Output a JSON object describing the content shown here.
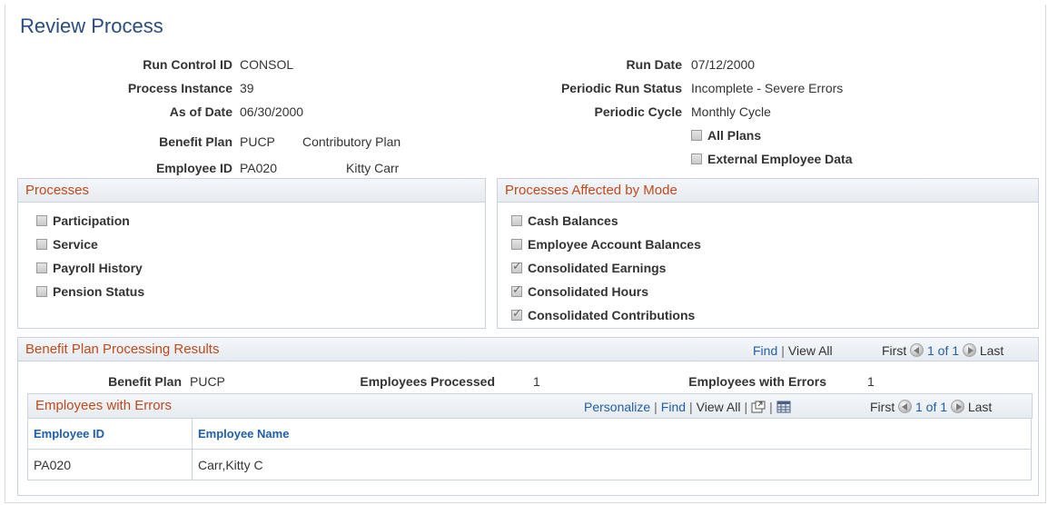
{
  "page": {
    "title": "Review Process"
  },
  "header_left": {
    "run_control_id": {
      "label": "Run Control ID",
      "value": "CONSOL"
    },
    "process_instance": {
      "label": "Process Instance",
      "value": "39"
    },
    "as_of_date": {
      "label": "As of Date",
      "value": "06/30/2000"
    },
    "benefit_plan": {
      "label": "Benefit Plan",
      "value": "PUCP",
      "description": "Contributory Plan"
    },
    "employee_id": {
      "label": "Employee ID",
      "value": "PA020",
      "name": "Kitty Carr"
    }
  },
  "header_right": {
    "run_date": {
      "label": "Run Date",
      "value": "07/12/2000"
    },
    "periodic_run_status": {
      "label": "Periodic Run Status",
      "value": "Incomplete - Severe Errors"
    },
    "periodic_cycle": {
      "label": "Periodic Cycle",
      "value": "Monthly Cycle"
    },
    "all_plans": {
      "label": "All Plans",
      "checked": false
    },
    "external_employee_data": {
      "label": "External Employee Data",
      "checked": false
    }
  },
  "processes": {
    "title": "Processes",
    "items": [
      {
        "label": "Participation",
        "checked": false
      },
      {
        "label": "Service",
        "checked": false
      },
      {
        "label": "Payroll History",
        "checked": false
      },
      {
        "label": "Pension Status",
        "checked": false
      }
    ]
  },
  "affected": {
    "title": "Processes Affected by Mode",
    "items": [
      {
        "label": "Cash Balances",
        "checked": false
      },
      {
        "label": "Employee Account Balances",
        "checked": false
      },
      {
        "label": "Consolidated Earnings",
        "checked": true
      },
      {
        "label": "Consolidated Hours",
        "checked": true
      },
      {
        "label": "Consolidated Contributions",
        "checked": true
      }
    ]
  },
  "results": {
    "title": "Benefit Plan Processing Results",
    "find": "Find",
    "view_all": "View All",
    "first": "First",
    "range": "1 of 1",
    "last": "Last",
    "benefit_plan_label": "Benefit Plan",
    "benefit_plan_value": "PUCP",
    "employees_processed_label": "Employees Processed",
    "employees_processed_value": "1",
    "employees_with_errors_label": "Employees with Errors",
    "employees_with_errors_value": "1"
  },
  "errors_grid": {
    "title": "Employees with Errors",
    "personalize": "Personalize",
    "find": "Find",
    "view_all": "View All",
    "first": "First",
    "range": "1 of 1",
    "last": "Last",
    "columns": [
      "Employee ID",
      "Employee Name"
    ],
    "rows": [
      {
        "employee_id": "PA020",
        "employee_name": "Carr,Kitty C"
      }
    ]
  },
  "icons": [
    "checkbox-icon",
    "nav-prev-icon",
    "nav-next-icon",
    "zoom-icon",
    "download-grid-icon"
  ]
}
